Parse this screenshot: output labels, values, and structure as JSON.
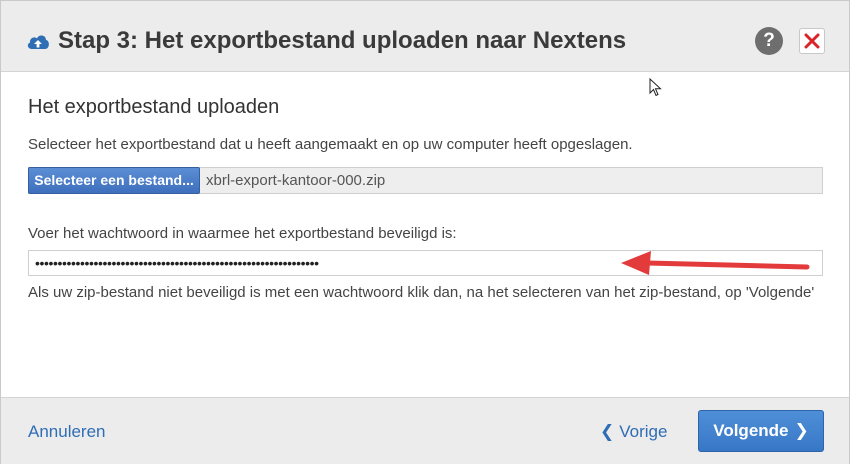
{
  "header": {
    "title": "Stap 3: Het exportbestand uploaden naar Nextens",
    "title_icon": "cloud-upload-icon",
    "help_label": "?",
    "close_icon": "close-icon"
  },
  "main": {
    "section_title": "Het exportbestand uploaden",
    "select_instruction": "Selecteer het exportbestand dat u heeft aangemaakt en op uw computer heeft opgeslagen.",
    "select_button_label": "Selecteer een bestand...",
    "selected_file": "xbrl-export-kantoor-000.zip",
    "password_instruction": "Voer het wachtwoord in waarmee het exportbestand beveiligd is:",
    "password_value": "•••••••••••••••••••••••••••••••••••••••••••••••••••••••••••••••",
    "note": "Als uw zip-bestand niet beveiligd is met een wachtwoord klik dan, na het selecteren van het zip-bestand, op 'Volgende'"
  },
  "footer": {
    "cancel_label": "Annuleren",
    "prev_label": "Vorige",
    "next_label": "Volgende"
  },
  "colors": {
    "accent": "#3777c6",
    "link": "#2f6db5",
    "annotation_arrow": "#e33b3b",
    "close_x": "#d9242a"
  }
}
